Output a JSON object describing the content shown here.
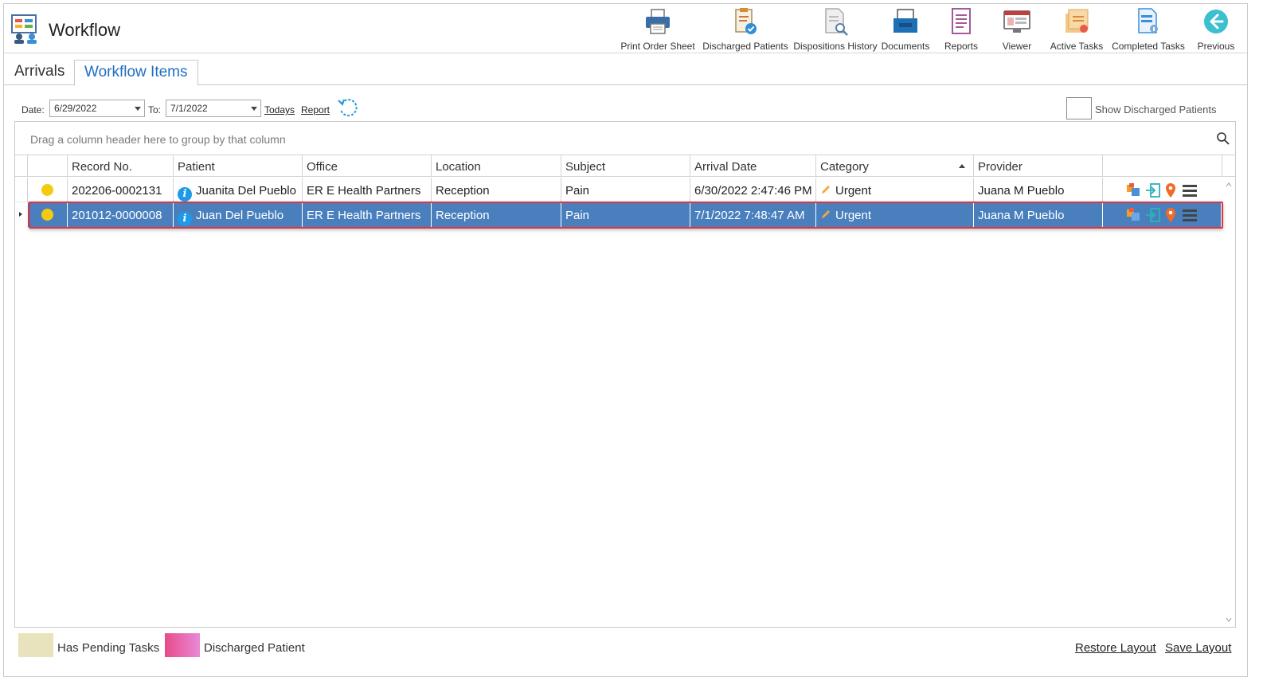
{
  "header": {
    "title": "Workflow",
    "toolbar": [
      {
        "label": "Print Order Sheet",
        "icon": "printer-icon"
      },
      {
        "label": "Discharged Patients",
        "icon": "discharged-patients-icon"
      },
      {
        "label": "Dispositions History",
        "icon": "dispositions-history-icon"
      },
      {
        "label": "Documents",
        "icon": "documents-icon"
      },
      {
        "label": "Reports",
        "icon": "reports-icon"
      },
      {
        "label": "Viewer",
        "icon": "viewer-icon"
      },
      {
        "label": "Active Tasks",
        "icon": "active-tasks-icon"
      },
      {
        "label": "Completed Tasks",
        "icon": "completed-tasks-icon"
      },
      {
        "label": "Previous",
        "icon": "previous-icon"
      }
    ]
  },
  "tabs": [
    {
      "label": "Arrivals",
      "active": false
    },
    {
      "label": "Workflow Items",
      "active": true
    }
  ],
  "filters": {
    "date_label": "Date:",
    "date_value": "6/29/2022",
    "to_label": "To:",
    "to_value": "7/1/2022",
    "todays_link": "Todays",
    "report_link": "Report",
    "show_discharged_label": "Show Discharged Patients",
    "show_discharged_checked": false
  },
  "grid": {
    "group_by_hint": "Drag a column header here to group by that column",
    "columns": [
      "Record No.",
      "Patient",
      "Office",
      "Location",
      "Subject",
      "Arrival Date",
      "Category",
      "Provider"
    ],
    "sorted_column": "Category",
    "rows": [
      {
        "status_color": "#f5cb10",
        "record_no": "202206-0002131",
        "patient": "Juanita Del Pueblo",
        "office": "ER E Health Partners",
        "location": "Reception",
        "subject": "Pain",
        "arrival_date": "6/30/2022 2:47:46 PM",
        "category": "Urgent",
        "provider": "Juana M Pueblo",
        "selected": false
      },
      {
        "status_color": "#f5cb10",
        "record_no": "201012-0000008",
        "patient": "Juan Del Pueblo",
        "office": "ER E Health Partners",
        "location": "Reception",
        "subject": "Pain",
        "arrival_date": "7/1/2022 7:48:47 AM",
        "category": "Urgent",
        "provider": "Juana M Pueblo",
        "selected": true
      }
    ]
  },
  "legend": [
    {
      "label": "Has Pending Tasks",
      "color": "#e8e2bd"
    },
    {
      "label": "Discharged Patient",
      "color": "#e85a9a"
    }
  ],
  "footer_links": {
    "restore_layout": "Restore Layout",
    "save_layout": "Save Layout"
  },
  "colors": {
    "accent_blue": "#1e6fc2",
    "selected_row": "#4a7fbd",
    "selection_outline": "#e0343f"
  }
}
